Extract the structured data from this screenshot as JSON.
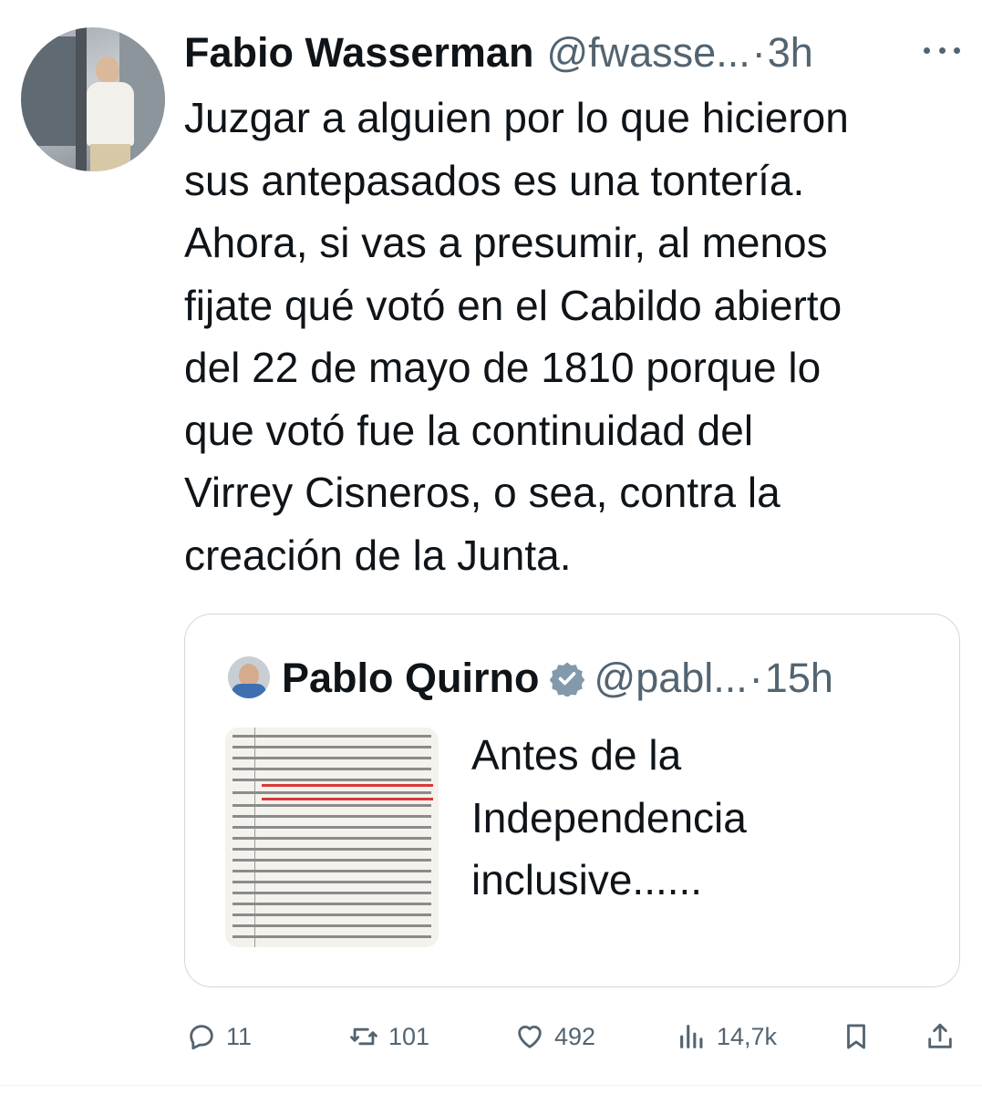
{
  "post": {
    "author_name": "Fabio Wasserman",
    "author_handle": "@fwasse...",
    "separator": "·",
    "time": "3h",
    "text_lines": [
      "Juzgar a alguien por lo que hicieron",
      "sus antepasados es una tontería.",
      "Ahora, si vas a presumir, al menos",
      "fijate qué votó en el Cabildo abierto",
      "del 22 de mayo de 1810 porque lo",
      "que votó fue la continuidad del",
      "Virrey Cisneros, o sea, contra la",
      "creación de la Junta."
    ]
  },
  "quote": {
    "author_name": "Pablo Quirno",
    "author_handle": "@pabl...",
    "separator": "·",
    "time": "15h",
    "text_lines": [
      "Antes de la",
      "Independencia",
      "inclusive......"
    ]
  },
  "actions": {
    "replies": "11",
    "reposts": "101",
    "likes": "492",
    "views": "14,7k"
  },
  "icons": {
    "more": "more-dots-icon",
    "reply": "reply-icon",
    "repost": "repost-icon",
    "like": "heart-icon",
    "views": "views-chart-icon",
    "bookmark": "bookmark-icon",
    "share": "share-icon",
    "verified": "verified-badge-icon"
  },
  "colors": {
    "text": "#0f1419",
    "secondary": "#536471",
    "border": "#cfd9de",
    "verified_badge": "#829aab"
  }
}
